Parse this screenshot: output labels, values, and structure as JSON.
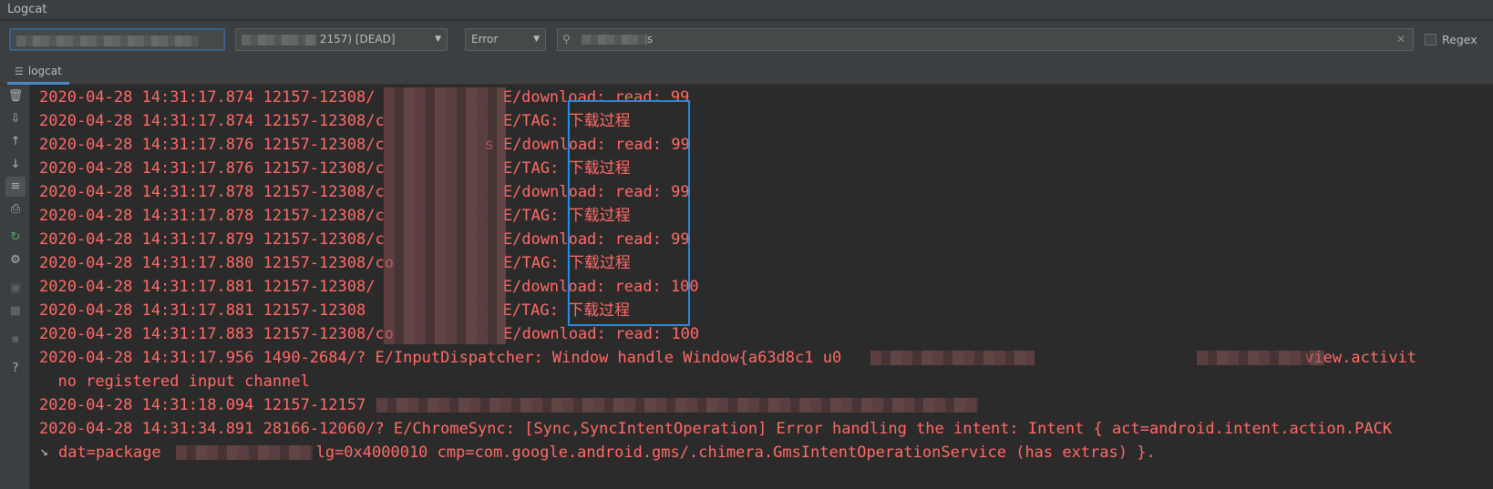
{
  "window": {
    "title": "Logcat"
  },
  "toolbar": {
    "device_value": "",
    "process_value": "2157) [DEAD]",
    "level_value": "Error",
    "search_value": "s",
    "regex_label": "Regex"
  },
  "tabs": [
    {
      "label": "logcat"
    }
  ],
  "sidebar": {
    "icons": [
      "trash-icon",
      "scroll-to-end-icon",
      "arrow-up-icon",
      "arrow-down-icon",
      "soft-wrap-icon",
      "print-icon",
      "restart-icon",
      "settings-icon",
      "screenshot-icon",
      "record-icon",
      "stop-icon",
      "help-icon"
    ],
    "help_label": "?"
  },
  "log_lines": [
    {
      "prefix": "2020-04-28 14:31:17.874 12157-12308/",
      "message": " E/download: read: 99"
    },
    {
      "prefix": "2020-04-28 14:31:17.874 12157-12308/c",
      "message": " E/TAG: 下载过程"
    },
    {
      "prefix": "2020-04-28 14:31:17.876 12157-12308/c",
      "message": "s E/download: read: 99"
    },
    {
      "prefix": "2020-04-28 14:31:17.876 12157-12308/c",
      "message": " E/TAG: 下载过程"
    },
    {
      "prefix": "2020-04-28 14:31:17.878 12157-12308/c",
      "message": " E/download: read: 99"
    },
    {
      "prefix": "2020-04-28 14:31:17.878 12157-12308/c",
      "message": " E/TAG: 下载过程"
    },
    {
      "prefix": "2020-04-28 14:31:17.879 12157-12308/c",
      "message": " E/download: read: 99"
    },
    {
      "prefix": "2020-04-28 14:31:17.880 12157-12308/co",
      "message": " E/TAG: 下载过程"
    },
    {
      "prefix": "2020-04-28 14:31:17.881 12157-12308/",
      "message": " E/download: read: 100"
    },
    {
      "prefix": "2020-04-28 14:31:17.881 12157-12308",
      "message": " E/TAG: 下载过程"
    },
    {
      "prefix": "2020-04-28 14:31:17.883 12157-12308/co",
      "message": " E/download: read: 100"
    },
    {
      "prefix": "2020-04-28 14:31:17.956 1490-2684/? E/InputDispatcher: Window handle Window{a63d8c1 u0",
      "message": "view.activit"
    },
    {
      "prefix": "  no registered input channel",
      "message": ""
    },
    {
      "prefix": "2020-04-28 14:31:18.094 12157-12157",
      "message": ""
    },
    {
      "prefix": "2020-04-28 14:31:34.891 28166-12060/? E/ChromeSync: [Sync,SyncIntentOperation] Error handling the intent: Intent { act=android.intent.action.PACK",
      "message": ""
    },
    {
      "prefix": "dat=package",
      "message": "lg=0x4000010 cmp=com.google.android.gms/.chimera.GmsIntentOperationService (has extras) }."
    }
  ],
  "colors": {
    "error_text": "#ff6b68",
    "highlight_box": "#2e8ad8",
    "panel_bg": "#2b2b2b",
    "toolbar_bg": "#3c3f41"
  }
}
